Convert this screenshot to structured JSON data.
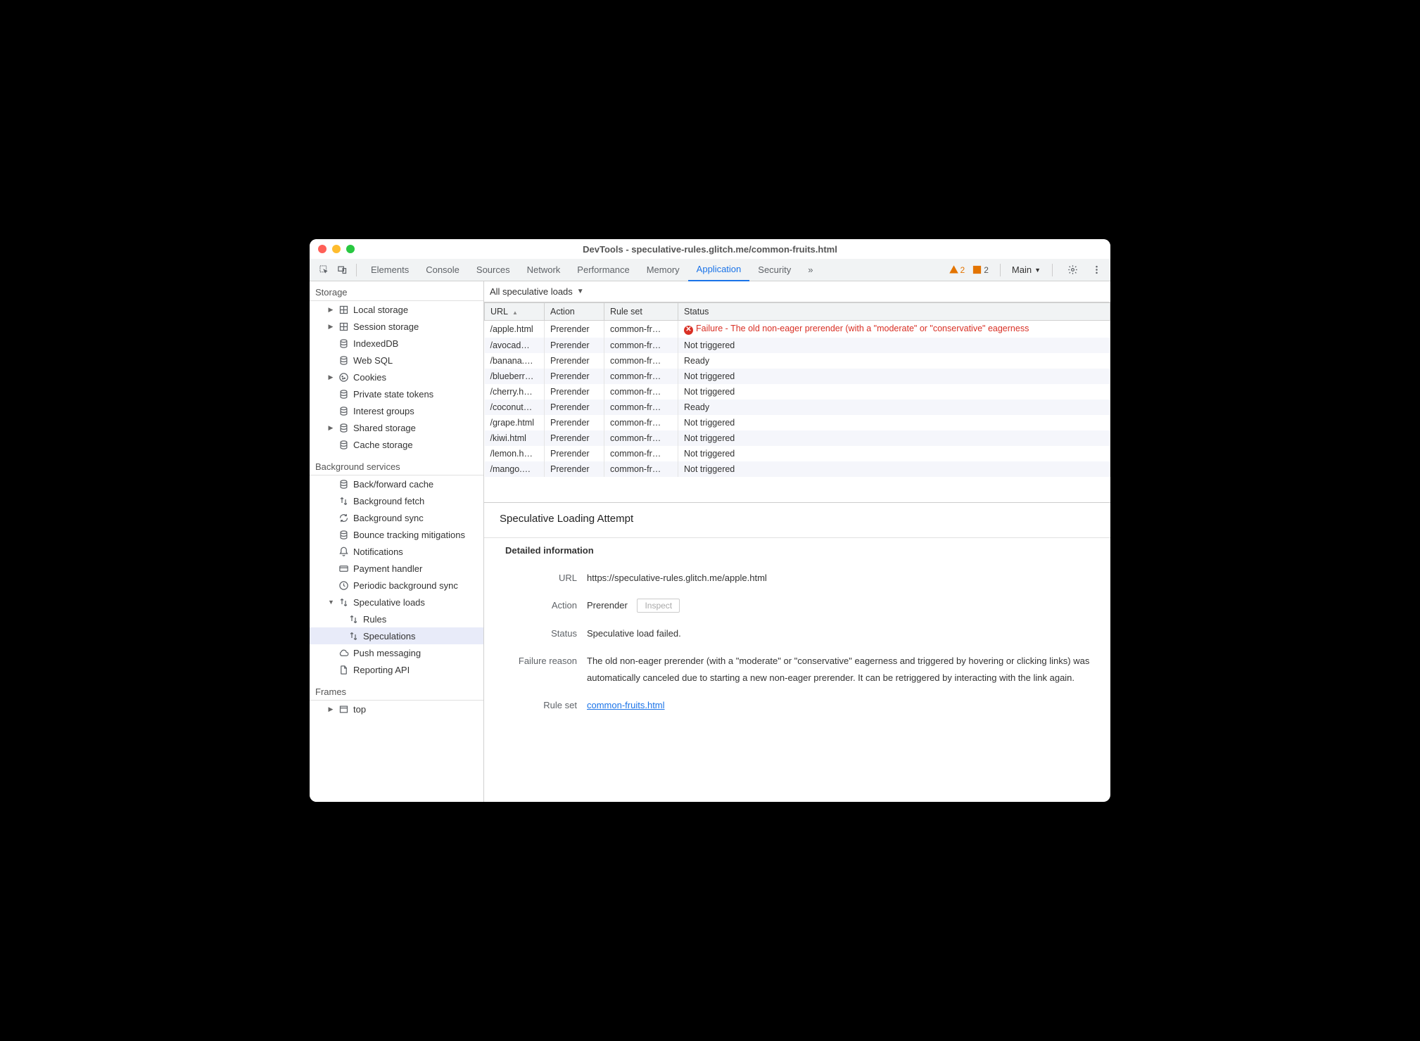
{
  "window": {
    "title": "DevTools - speculative-rules.glitch.me/common-fruits.html"
  },
  "toolbar": {
    "tabs": [
      "Elements",
      "Console",
      "Sources",
      "Network",
      "Performance",
      "Memory",
      "Application",
      "Security"
    ],
    "active_tab": "Application",
    "overflow": "»",
    "warn_count": "2",
    "err_count": "2",
    "main_label": "Main"
  },
  "sidebar": {
    "sections": [
      {
        "title": "Storage",
        "items": [
          {
            "label": "Local storage",
            "icon": "grid",
            "caret": true
          },
          {
            "label": "Session storage",
            "icon": "grid",
            "caret": true
          },
          {
            "label": "IndexedDB",
            "icon": "db"
          },
          {
            "label": "Web SQL",
            "icon": "db"
          },
          {
            "label": "Cookies",
            "icon": "cookie",
            "caret": true
          },
          {
            "label": "Private state tokens",
            "icon": "db"
          },
          {
            "label": "Interest groups",
            "icon": "db"
          },
          {
            "label": "Shared storage",
            "icon": "db",
            "caret": true
          },
          {
            "label": "Cache storage",
            "icon": "db"
          }
        ]
      },
      {
        "title": "Background services",
        "items": [
          {
            "label": "Back/forward cache",
            "icon": "db"
          },
          {
            "label": "Background fetch",
            "icon": "arrows"
          },
          {
            "label": "Background sync",
            "icon": "sync"
          },
          {
            "label": "Bounce tracking mitigations",
            "icon": "db"
          },
          {
            "label": "Notifications",
            "icon": "bell"
          },
          {
            "label": "Payment handler",
            "icon": "card"
          },
          {
            "label": "Periodic background sync",
            "icon": "clock"
          },
          {
            "label": "Speculative loads",
            "icon": "arrows",
            "caret": true,
            "open": true,
            "children": [
              {
                "label": "Rules",
                "icon": "arrows"
              },
              {
                "label": "Speculations",
                "icon": "arrows",
                "selected": true
              }
            ]
          },
          {
            "label": "Push messaging",
            "icon": "cloud"
          },
          {
            "label": "Reporting API",
            "icon": "file"
          }
        ]
      },
      {
        "title": "Frames",
        "items": [
          {
            "label": "top",
            "icon": "frame",
            "caret": true
          }
        ]
      }
    ]
  },
  "filter": {
    "label": "All speculative loads"
  },
  "table": {
    "headers": [
      "URL",
      "Action",
      "Rule set",
      "Status"
    ],
    "rows": [
      {
        "url": "/apple.html",
        "action": "Prerender",
        "ruleset": "common-fr…",
        "status": "Failure - The old non-eager prerender (with a \"moderate\" or \"conservative\" eagerness",
        "fail": true
      },
      {
        "url": "/avocad…",
        "action": "Prerender",
        "ruleset": "common-fr…",
        "status": "Not triggered"
      },
      {
        "url": "/banana.…",
        "action": "Prerender",
        "ruleset": "common-fr…",
        "status": "Ready"
      },
      {
        "url": "/blueberr…",
        "action": "Prerender",
        "ruleset": "common-fr…",
        "status": "Not triggered"
      },
      {
        "url": "/cherry.h…",
        "action": "Prerender",
        "ruleset": "common-fr…",
        "status": "Not triggered"
      },
      {
        "url": "/coconut…",
        "action": "Prerender",
        "ruleset": "common-fr…",
        "status": "Ready"
      },
      {
        "url": "/grape.html",
        "action": "Prerender",
        "ruleset": "common-fr…",
        "status": "Not triggered"
      },
      {
        "url": "/kiwi.html",
        "action": "Prerender",
        "ruleset": "common-fr…",
        "status": "Not triggered"
      },
      {
        "url": "/lemon.h…",
        "action": "Prerender",
        "ruleset": "common-fr…",
        "status": "Not triggered"
      },
      {
        "url": "/mango.…",
        "action": "Prerender",
        "ruleset": "common-fr…",
        "status": "Not triggered"
      }
    ]
  },
  "detail": {
    "title": "Speculative Loading Attempt",
    "section": "Detailed information",
    "url_label": "URL",
    "url": "https://speculative-rules.glitch.me/apple.html",
    "action_label": "Action",
    "action": "Prerender",
    "inspect": "Inspect",
    "status_label": "Status",
    "status": "Speculative load failed.",
    "failreason_label": "Failure reason",
    "failreason": "The old non-eager prerender (with a \"moderate\" or \"conservative\" eagerness and triggered by hovering or clicking links) was automatically canceled due to starting a new non-eager prerender. It can be retriggered by interacting with the link again.",
    "ruleset_label": "Rule set",
    "ruleset": "common-fruits.html"
  }
}
